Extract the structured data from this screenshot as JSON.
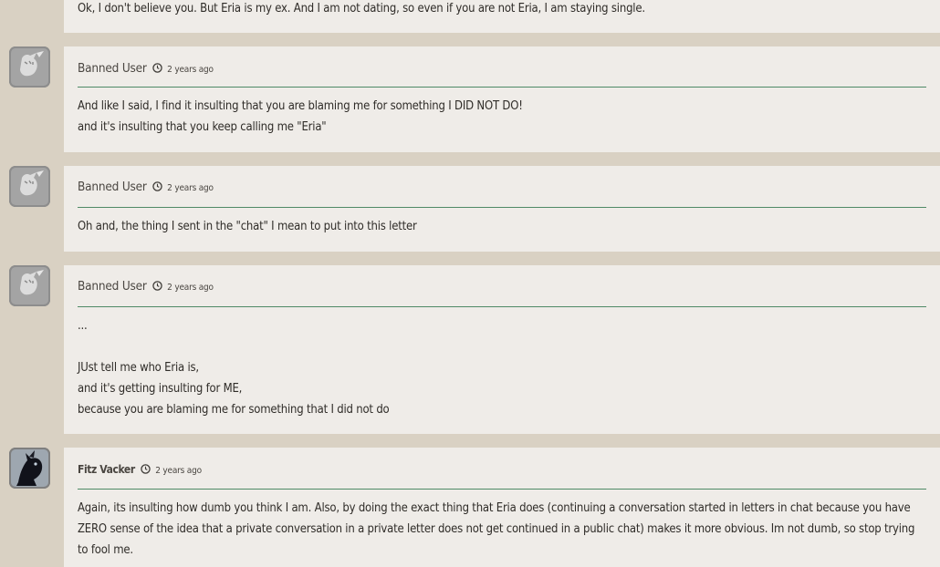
{
  "posts": [
    {
      "username": "",
      "time": "",
      "lines": [
        "Ok, I don't believe you. But Eria is my ex. And I am not dating, so even if you are not Eria, I am staying single."
      ]
    },
    {
      "username": "Banned User",
      "time": "2 years ago",
      "lines": [
        "And like I said, I find it insulting that you are blaming me for something I DID NOT DO!",
        "and it's insulting that you keep calling me \"Eria\""
      ]
    },
    {
      "username": "Banned User",
      "time": "2 years ago",
      "lines": [
        "Oh and, the thing I sent in the \"chat\" I mean to put into this letter"
      ]
    },
    {
      "username": "Banned User",
      "time": "2 years ago",
      "lines": [
        "...",
        "",
        "JUst tell me who Eria is,",
        "and it's getting insulting for ME,",
        "because you are blaming me for something that I did not do"
      ]
    },
    {
      "username": "Fitz Vacker",
      "time": "2 years ago",
      "lines": [
        "Again, its insulting how dumb you think I am. Also, by doing the exact thing that Eria does (continuing a conversation started in letters in chat because you have ZERO sense of the idea that a private conversation in a private letter does not get continued in a public chat) makes it more obvious. Im not dumb, so stop trying to fool me."
      ]
    }
  ],
  "icons": {
    "avatar_default": "default-dragon-avatar-icon",
    "avatar_fitz": "dark-dragon-avatar-icon",
    "clock": "clock-icon"
  },
  "colors": {
    "page_background": "#d9d1c3",
    "post_background": "#efece8",
    "divider": "#4f8a66",
    "text": "#2f2c28"
  }
}
